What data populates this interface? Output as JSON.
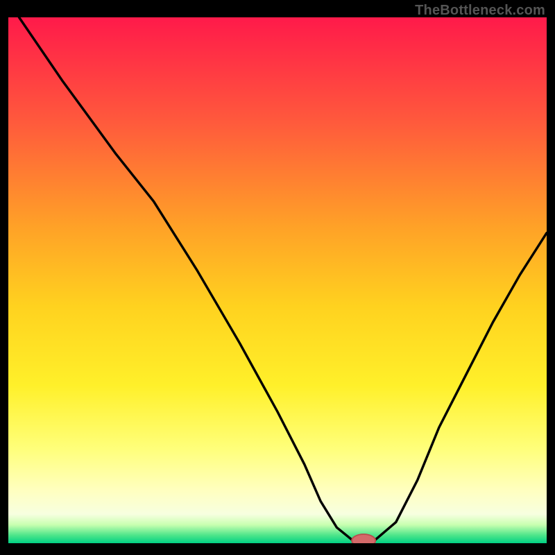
{
  "attribution": "TheBottleneck.com",
  "colors": {
    "black": "#000000",
    "curve": "#000000",
    "marker_fill": "#d46a6a",
    "marker_stroke": "#b94e4e"
  },
  "chart_data": {
    "type": "line",
    "title": "",
    "xlabel": "",
    "ylabel": "",
    "xlim": [
      0,
      100
    ],
    "ylim": [
      0,
      100
    ],
    "gradient_stops": [
      {
        "offset": 0.0,
        "color": "#ff1a4a"
      },
      {
        "offset": 0.2,
        "color": "#ff5a3c"
      },
      {
        "offset": 0.4,
        "color": "#ffa227"
      },
      {
        "offset": 0.55,
        "color": "#ffd21f"
      },
      {
        "offset": 0.7,
        "color": "#fff02a"
      },
      {
        "offset": 0.82,
        "color": "#ffff7a"
      },
      {
        "offset": 0.9,
        "color": "#ffffc0"
      },
      {
        "offset": 0.945,
        "color": "#f7ffe0"
      },
      {
        "offset": 0.965,
        "color": "#c8ffb0"
      },
      {
        "offset": 0.985,
        "color": "#4de58a"
      },
      {
        "offset": 1.0,
        "color": "#00d084"
      }
    ],
    "series": [
      {
        "name": "bottleneck-curve",
        "x": [
          2,
          10,
          20,
          27,
          35,
          43,
          50,
          55,
          58,
          61,
          64,
          68,
          72,
          76,
          80,
          85,
          90,
          95,
          100
        ],
        "y": [
          100,
          88,
          74,
          65,
          52,
          38,
          25,
          15,
          8,
          3,
          0.5,
          0.5,
          4,
          12,
          22,
          32,
          42,
          51,
          59
        ]
      }
    ],
    "marker": {
      "x": 66,
      "y": 0.5,
      "rx": 2.2,
      "ry": 1.2
    }
  }
}
